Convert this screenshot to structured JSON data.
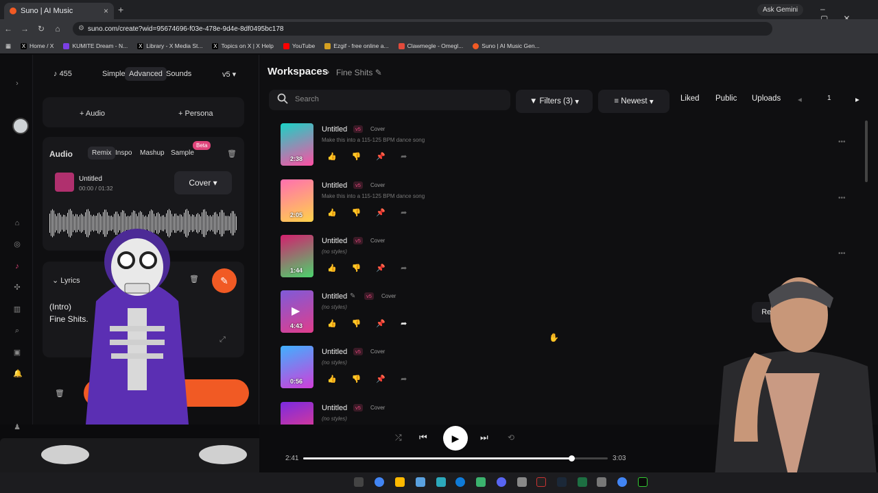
{
  "browser": {
    "tab_title": "Suno | AI Music",
    "gemini": "Ask Gemini",
    "url": "suno.com/create?wid=95674696-f03e-478e-9d4e-8df0495bc178",
    "bookmarks": [
      "Home / X",
      "KUMITE Dream - N...",
      "Library - X Media St...",
      "Topics on X | X Help",
      "YouTube",
      "Ezgif - free online a...",
      "Clawmegle - Omegl...",
      "Suno | AI Music Gen..."
    ]
  },
  "panel": {
    "credits": "455",
    "modes": [
      "Simple",
      "Advanced",
      "Sounds"
    ],
    "version": "v5",
    "add_audio": "Audio",
    "add_persona": "Persona",
    "audio_label": "Audio",
    "audio_tabs": [
      "Remix",
      "Inspo",
      "Mashup",
      "Sample"
    ],
    "beta": "Beta",
    "clip_title": "Untitled",
    "clip_time": "00:00 / 01:32",
    "cover_select": "Cover",
    "lyrics_label": "Lyrics",
    "lyrics_text": [
      "(Intro)",
      "Fine Shits."
    ]
  },
  "workspace": {
    "title": "Workspaces",
    "current": "Fine Shits",
    "search_placeholder": "Search",
    "filters": "Filters (3)",
    "sort": "Newest",
    "liked": "Liked",
    "public": "Public",
    "uploads": "Uploads",
    "page": "1"
  },
  "songs": [
    {
      "title": "Untitled",
      "version": "v5",
      "type": "Cover",
      "desc": "Make this into a 115-125 BPM dance song",
      "duration": "2:38"
    },
    {
      "title": "Untitled",
      "version": "v5",
      "type": "Cover",
      "desc": "Make this into a 115-125 BPM dance song",
      "duration": "2:05"
    },
    {
      "title": "Untitled",
      "version": "v5",
      "type": "Cover",
      "desc": "(no styles)",
      "duration": "1:44"
    },
    {
      "title": "Untitled",
      "version": "v5",
      "type": "Cover",
      "desc": "(no styles)",
      "duration": "4:43"
    },
    {
      "title": "Untitled",
      "version": "v5",
      "type": "Cover",
      "desc": "(no styles)",
      "duration": "0:56"
    },
    {
      "title": "Untitled",
      "version": "v5",
      "type": "Cover",
      "desc": "(no styles)",
      "duration": ""
    }
  ],
  "remix_label": "Remix/E",
  "player": {
    "elapsed": "2:41",
    "total": "3:03",
    "progress": 0.88
  },
  "colors": {
    "accent": "#f15a24",
    "tag": "#e0457b"
  }
}
